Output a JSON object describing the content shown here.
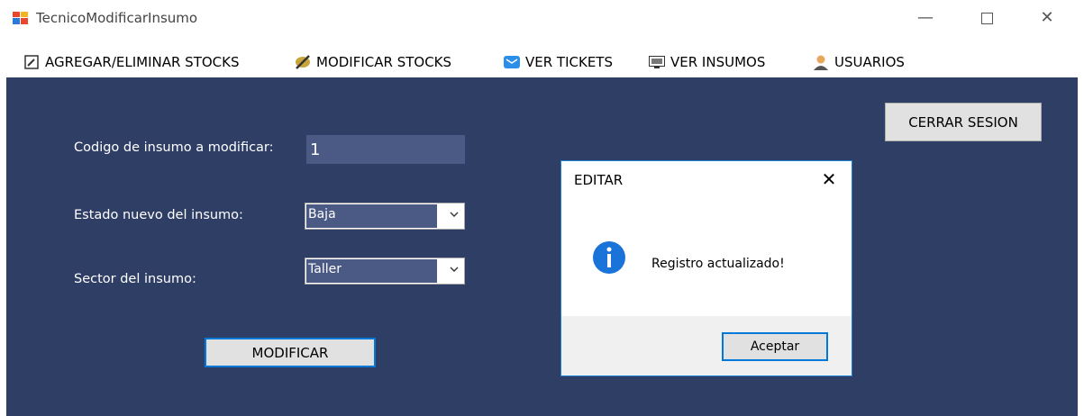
{
  "window": {
    "title": "TecnicoModificarInsumo",
    "controls": {
      "minimize": "—",
      "close": "✕"
    }
  },
  "menu": {
    "items": [
      {
        "label": "AGREGAR/ELIMINAR STOCKS",
        "icon": "edit-note-icon"
      },
      {
        "label": "MODIFICAR STOCKS",
        "icon": "pencil-icon"
      },
      {
        "label": "VER TICKETS",
        "icon": "envelope-icon"
      },
      {
        "label": "VER INSUMOS",
        "icon": "monitor-icon"
      },
      {
        "label": "USUARIOS",
        "icon": "user-icon"
      }
    ]
  },
  "form": {
    "code_label": "Codigo de insumo a modificar:",
    "code_value": "1",
    "estado_label": "Estado nuevo del insumo:",
    "estado_value": "Baja",
    "sector_label": "Sector del insumo:",
    "sector_value": "Taller",
    "modificar_button": "MODIFICAR",
    "cerrar_button": "CERRAR SESION"
  },
  "dialog": {
    "title": "EDITAR",
    "message": "Registro actualizado!",
    "close_glyph": "✕",
    "accept_button": "Aceptar",
    "icon": "info-icon"
  },
  "colors": {
    "panel_bg": "#2f3e65",
    "input_bg": "#4a5a85",
    "accent": "#0078d7"
  }
}
